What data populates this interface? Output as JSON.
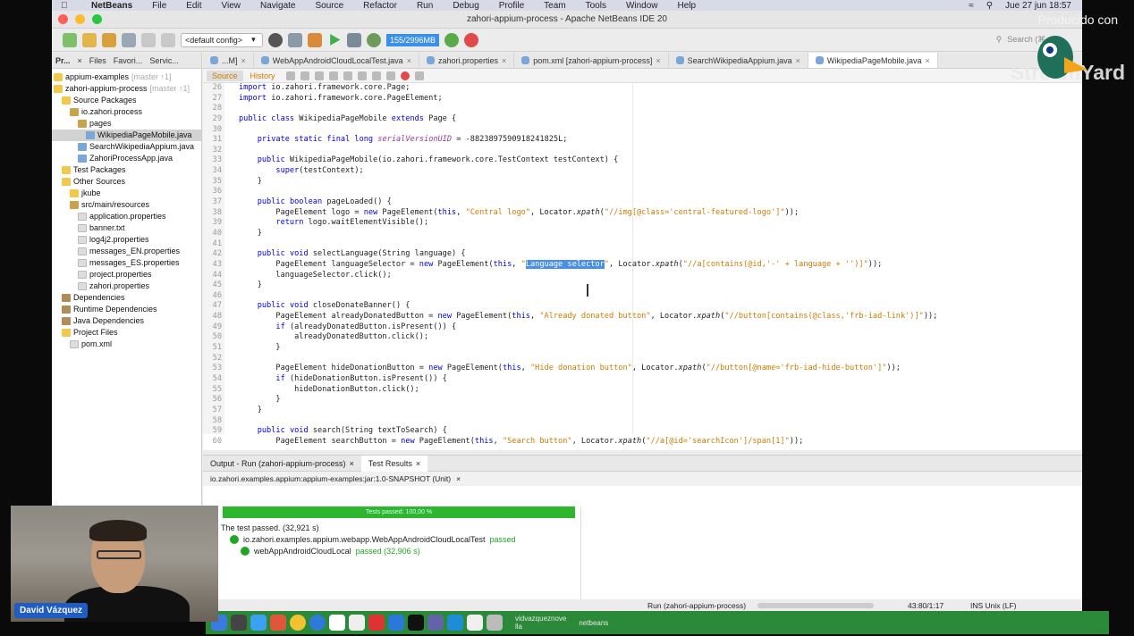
{
  "menubar": {
    "app": "NetBeans",
    "items": [
      "File",
      "Edit",
      "View",
      "Navigate",
      "Source",
      "Refactor",
      "Run",
      "Debug",
      "Profile",
      "Team",
      "Tools",
      "Window",
      "Help"
    ],
    "clock": "Jue 27 jun 18:57"
  },
  "window": {
    "title": "zahori-appium-process - Apache NetBeans IDE 20"
  },
  "toolbar": {
    "config": "<default config>",
    "memory": "155/2996MB",
    "search_placeholder": "Search (⌘+I)"
  },
  "left_panel": {
    "tabs": [
      "Pr...",
      "Files",
      "Favori...",
      "Servic..."
    ],
    "tree": [
      {
        "label": "appium-examples",
        "extra": "[master ↑1]",
        "indent": 0,
        "type": "project"
      },
      {
        "label": "zahori-appium-process",
        "extra": "[master ↑1]",
        "indent": 0,
        "type": "project"
      },
      {
        "label": "Source Packages",
        "extra": "",
        "indent": 1,
        "type": "folder"
      },
      {
        "label": "io.zahori.process",
        "extra": "",
        "indent": 2,
        "type": "pkg"
      },
      {
        "label": "pages",
        "extra": "",
        "indent": 3,
        "type": "pkg"
      },
      {
        "label": "WikipediaPageMobile.java",
        "extra": "",
        "indent": 4,
        "type": "java",
        "selected": true
      },
      {
        "label": "SearchWikipediaAppium.java",
        "extra": "",
        "indent": 3,
        "type": "java"
      },
      {
        "label": "ZahoriProcessApp.java",
        "extra": "",
        "indent": 3,
        "type": "java"
      },
      {
        "label": "Test Packages",
        "extra": "",
        "indent": 1,
        "type": "folder"
      },
      {
        "label": "Other Sources",
        "extra": "",
        "indent": 1,
        "type": "folder"
      },
      {
        "label": "jkube",
        "extra": "",
        "indent": 2,
        "type": "folder"
      },
      {
        "label": "src/main/resources",
        "extra": "",
        "indent": 2,
        "type": "pkg"
      },
      {
        "label": "application.properties",
        "extra": "",
        "indent": 3,
        "type": "txt"
      },
      {
        "label": "banner.txt",
        "extra": "",
        "indent": 3,
        "type": "txt"
      },
      {
        "label": "log4j2.properties",
        "extra": "",
        "indent": 3,
        "type": "txt"
      },
      {
        "label": "messages_EN.properties",
        "extra": "",
        "indent": 3,
        "type": "txt"
      },
      {
        "label": "messages_ES.properties",
        "extra": "",
        "indent": 3,
        "type": "txt"
      },
      {
        "label": "project.properties",
        "extra": "",
        "indent": 3,
        "type": "txt"
      },
      {
        "label": "zahori.properties",
        "extra": "",
        "indent": 3,
        "type": "txt"
      },
      {
        "label": "Dependencies",
        "extra": "",
        "indent": 1,
        "type": "jar"
      },
      {
        "label": "Runtime Dependencies",
        "extra": "",
        "indent": 1,
        "type": "jar"
      },
      {
        "label": "Java Dependencies",
        "extra": "",
        "indent": 1,
        "type": "jar"
      },
      {
        "label": "Project Files",
        "extra": "",
        "indent": 1,
        "type": "folder"
      },
      {
        "label": "pom.xml",
        "extra": "",
        "indent": 2,
        "type": "txt"
      }
    ]
  },
  "editor": {
    "tabs": [
      {
        "label": "...M]",
        "active": false
      },
      {
        "label": "WebAppAndroidCloudLocalTest.java",
        "active": false
      },
      {
        "label": "zahori.properties",
        "active": false
      },
      {
        "label": "pom.xml [zahori-appium-process]",
        "active": false
      },
      {
        "label": "SearchWikipediaAppium.java",
        "active": false
      },
      {
        "label": "WikipediaPageMobile.java",
        "active": true
      }
    ],
    "source_label": "Source",
    "history_label": "History",
    "line_numbers": [
      "26",
      "27",
      "28",
      "29",
      "30",
      "31",
      "32",
      "33",
      "34",
      "35",
      "36",
      "37",
      "38",
      "39",
      "40",
      "41",
      "42",
      "43",
      "44",
      "45",
      "46",
      "47",
      "48",
      "49",
      "50",
      "51",
      "52",
      "53",
      "54",
      "55",
      "56",
      "57",
      "58",
      "59",
      "60"
    ],
    "code_lines": [
      "import io.zahori.framework.core.Page;",
      "import io.zahori.framework.core.PageElement;",
      "",
      "public class WikipediaPageMobile extends Page {",
      "",
      "    private static final long serialVersionUID = -8823897590918241825L;",
      "",
      "    public WikipediaPageMobile(io.zahori.framework.core.TestContext testContext) {",
      "        super(testContext);",
      "    }",
      "",
      "    public boolean pageLoaded() {",
      "        PageElement logo = new PageElement(this, \"Central logo\", Locator.xpath(\"//img[@class='central-featured-logo']\"));",
      "        return logo.waitElementVisible();",
      "    }",
      "",
      "    public void selectLanguage(String language) {",
      "        PageElement languageSelector = new PageElement(this, \"Language selector\", Locator.xpath(\"//a[contains(@id,'-' + language + '')]\"));",
      "        languageSelector.click();",
      "    }",
      "",
      "    public void closeDonateBanner() {",
      "        PageElement alreadyDonatedButton = new PageElement(this, \"Already donated button\", Locator.xpath(\"//button[contains(@class,'frb-iad-link')]\"));",
      "        if (alreadyDonatedButton.isPresent()) {",
      "            alreadyDonatedButton.click();",
      "        }",
      "",
      "        PageElement hideDonationButton = new PageElement(this, \"Hide donation button\", Locator.xpath(\"//button[@name='frb-iad-hide-button']\"));",
      "        if (hideDonationButton.isPresent()) {",
      "            hideDonationButton.click();",
      "        }",
      "    }",
      "",
      "    public void search(String textToSearch) {",
      "        PageElement searchButton = new PageElement(this, \"Search button\", Locator.xpath(\"//a[@id='searchIcon']/span[1]\"));"
    ]
  },
  "bottom_panel": {
    "tabs": [
      {
        "label": "Output - Run (zahori-appium-process)",
        "active": false
      },
      {
        "label": "Test Results",
        "active": true
      }
    ],
    "session": "io.zahori.examples.appium:appium-examples:jar:1.0-SNAPSHOT (Unit)",
    "progress_text": "Tests passed: 100,00 %",
    "progress_fraction": 1.0,
    "summary": "The test passed. (32,921 s)",
    "suite": "io.zahori.examples.appium.webapp.WebAppAndroidCloudLocalTest",
    "suite_status": "passed",
    "test": "webAppAndroidCloudLocal",
    "test_status": "passed (32,906 s)"
  },
  "statusbar": {
    "run": "Run (zahori-appium-process)",
    "position": "43:80/1:17",
    "mode": "INS Unix (LF)"
  },
  "dock": {
    "user_line1": "vidvazqueznove",
    "user_line2": "lla",
    "netbeans": "netbeans"
  },
  "overlay": {
    "presenter": "David Vázquez",
    "produced_by": "Producido con",
    "brand": "StreamYard"
  },
  "colors": {
    "keyword": "#0000e6",
    "string": "#ce7b00",
    "selection": "#4a8fe7",
    "progress": "#2fb62f",
    "name_badge": "#1f5cc4"
  }
}
